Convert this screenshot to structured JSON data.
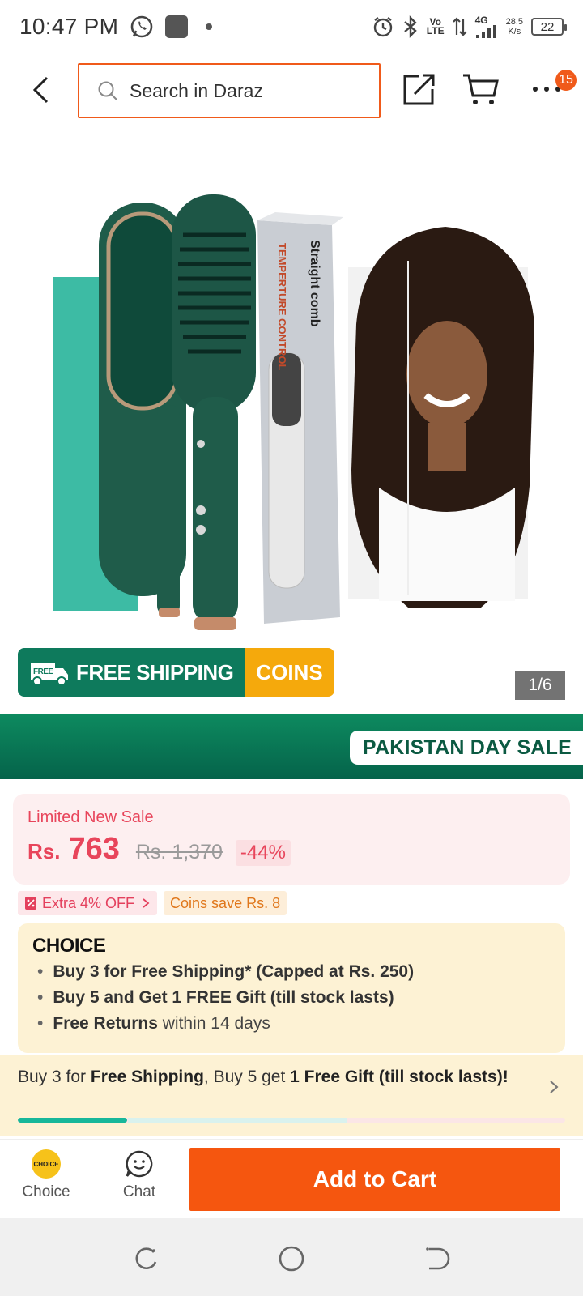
{
  "status_bar": {
    "time": "10:47 PM",
    "volte_top": "Vo",
    "volte_bottom": "LTE",
    "network": "4G",
    "speed_value": "28.5",
    "speed_unit": "K/s",
    "battery": "22"
  },
  "nav": {
    "search_placeholder": "Search in Daraz",
    "more_badge": "15"
  },
  "image": {
    "box_title": "Straight comb",
    "box_feature": "TEMPERTURE CONTROL",
    "promo_free_tag": "FREE",
    "promo_free_shipping": "FREE SHIPPING",
    "promo_coins": "COINS",
    "counter": "1/6"
  },
  "sale_banner": {
    "label": "PAKISTAN DAY SALE"
  },
  "price": {
    "label": "Limited New Sale",
    "currency": "Rs.",
    "current": "763",
    "original": "Rs. 1,370",
    "discount": "-44%"
  },
  "chips": {
    "extra": "Extra 4% OFF",
    "coins": "Coins save Rs. 8"
  },
  "choice": {
    "logo": "CHOICE",
    "items": [
      {
        "bold": "Buy 3 for  Free Shipping* (Capped at Rs. 250)",
        "rest": ""
      },
      {
        "bold": "Buy 5 and Get 1 FREE Gift (till stock lasts)",
        "rest": ""
      },
      {
        "bold": "Free Returns",
        "rest": " within 14 days"
      }
    ]
  },
  "shipping_progress": {
    "t1": "Buy 3 for ",
    "t2": "Free Shipping",
    "t3": ", Buy 5 get ",
    "t4": "1 Free Gift (till stock lasts)!",
    "progress_fraction": 0.2
  },
  "bottom_bar": {
    "choice_badge": "CHOICE",
    "choice_label": "Choice",
    "chat_label": "Chat",
    "add_to_cart": "Add to Cart"
  },
  "colors": {
    "brand_orange": "#f5560f",
    "sale_green": "#0b7a55",
    "price_red": "#e8455b",
    "choice_bg": "#fdf2d4"
  }
}
